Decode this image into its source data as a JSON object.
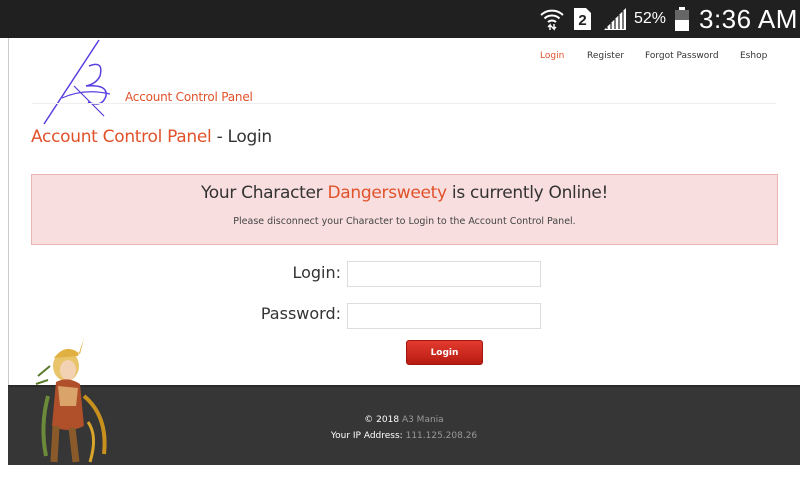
{
  "status_bar": {
    "sim_slot": "2",
    "battery_percent": "52%",
    "time": "3:36 AM",
    "icons": [
      "wifi-icon",
      "sim-icon",
      "signal-icon",
      "battery-icon"
    ]
  },
  "header": {
    "logo_text": "Account Control Panel",
    "nav": [
      {
        "label": "Login",
        "active": true
      },
      {
        "label": "Register",
        "active": false
      },
      {
        "label": "Forgot Password",
        "active": false
      },
      {
        "label": "Eshop",
        "active": false
      }
    ]
  },
  "page": {
    "heading_accent": "Account Control Panel",
    "heading_rest": " - Login"
  },
  "alert": {
    "prefix": "Your Character ",
    "character": "Dangersweety",
    "suffix": " is currently Online!",
    "message": "Please disconnect your Character to Login to the Account Control Panel."
  },
  "form": {
    "login_label": "Login:",
    "password_label": "Password:",
    "login_value": "",
    "password_value": "",
    "submit_label": "Login"
  },
  "footer": {
    "copyright_prefix": "© 2018",
    "site_name": "A3 Mania",
    "ip_label": "Your IP Address:",
    "ip_value": "111.125.208.26"
  },
  "colors": {
    "accent": "#e0522a",
    "alert_bg": "#f8dede",
    "button": "#d22a1f",
    "footer_bg": "#363636"
  }
}
